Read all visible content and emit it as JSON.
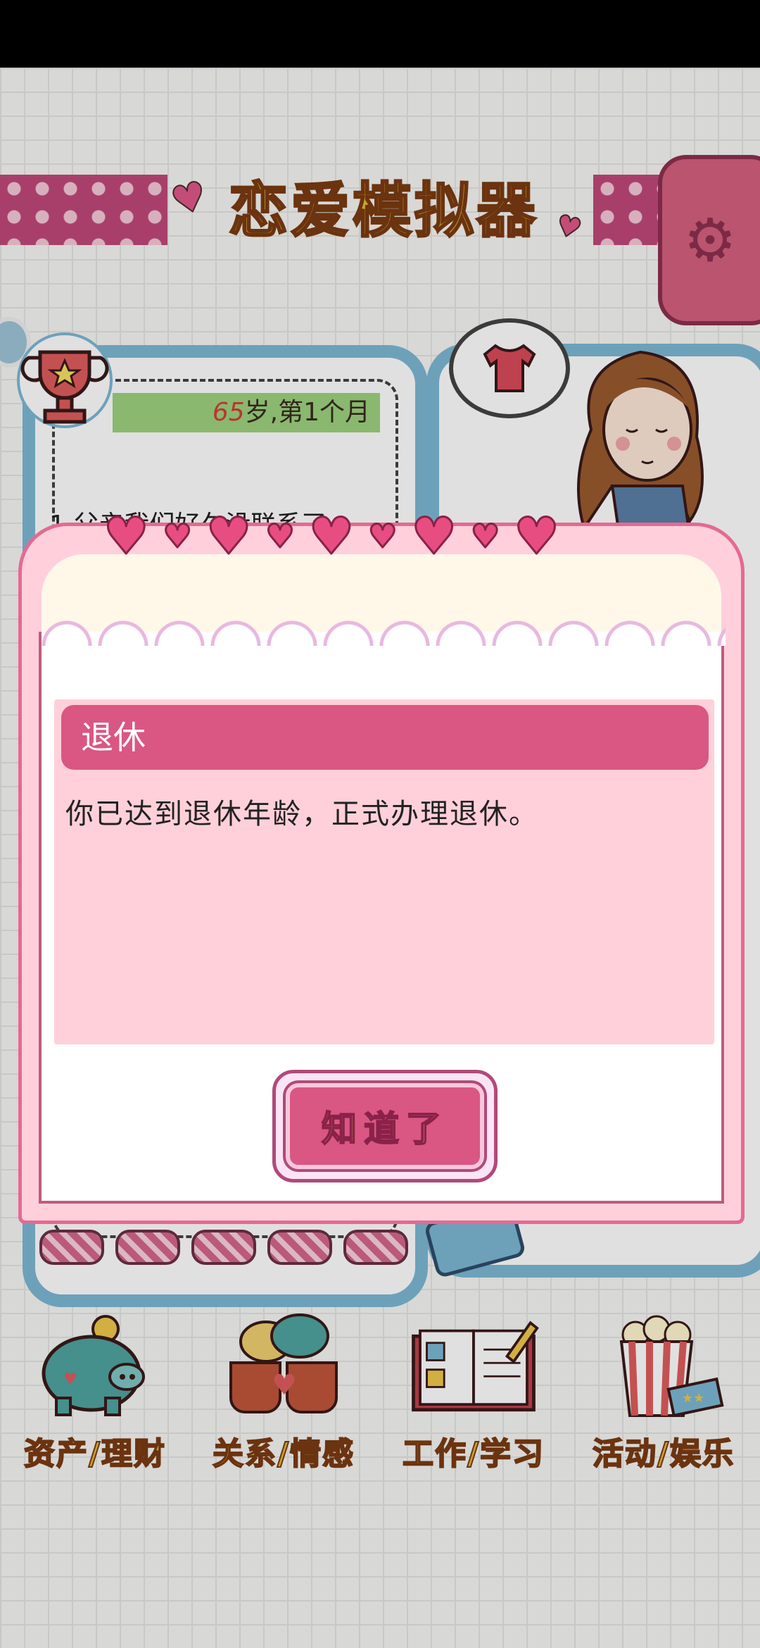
{
  "header": {
    "title": "恋爱模拟器",
    "settings_icon": "gear-icon"
  },
  "status": {
    "age_num": "65",
    "age_suffix": "岁,第",
    "month_num": "1",
    "month_suffix": "个月"
  },
  "event_log": {
    "first_line": "1.父亲我们好久没联系了"
  },
  "menu": {
    "items": [
      {
        "label": "资产/理财",
        "icon": "piggy-bank-icon"
      },
      {
        "label": "关系/情感",
        "icon": "coffee-cups-icon"
      },
      {
        "label": "工作/学习",
        "icon": "notebook-icon"
      },
      {
        "label": "活动/娱乐",
        "icon": "popcorn-icon"
      }
    ]
  },
  "dialog": {
    "title": "退休",
    "message": "你已达到退休年龄，正式办理退休。",
    "ok_label": "知道了"
  },
  "colors": {
    "accent_pink": "#d95782",
    "title_yellow": "#e2bb33",
    "panel_blue": "#7db8d4"
  }
}
